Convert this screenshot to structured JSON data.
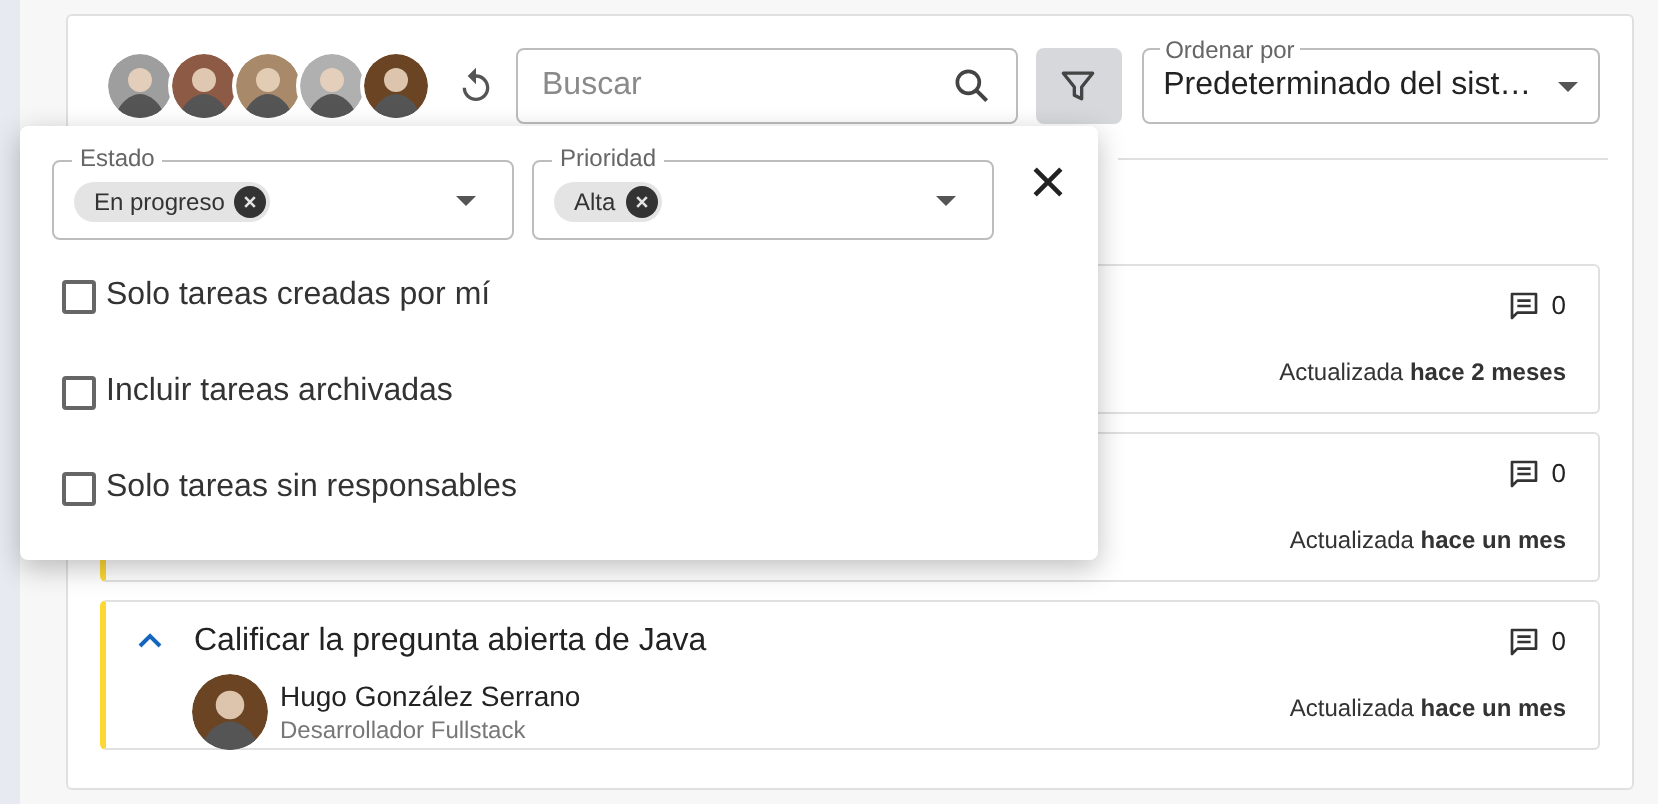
{
  "toolbar": {
    "search": {
      "placeholder": "Buscar"
    },
    "filter_button": {
      "selected": true
    },
    "sort": {
      "label": "Ordenar por",
      "value": "Predeterminado del sist…"
    }
  },
  "tasks": [
    {
      "comments": "0",
      "updated": "Actualizada **hace 2 meses**"
    },
    {
      "comments": "0",
      "updated": "Actualizada **hace un mes**"
    },
    {
      "expanded": true,
      "title": "Calificar la pregunta abierta de Java",
      "person": "Hugo González Serrano",
      "role": "Desarrollador Fullstack",
      "comments": "0",
      "updated": "Actualizada **hace un mes**"
    }
  ],
  "filter_panel": {
    "selects": [
      {
        "label": "Estado",
        "chips": [
          "En progreso"
        ]
      },
      {
        "label": "Prioridad",
        "chips": [
          "Alta"
        ]
      }
    ],
    "options": [
      {
        "label": "Solo tareas creadas por mí",
        "checked": false
      },
      {
        "label": "Incluir tareas archivadas",
        "checked": false
      },
      {
        "label": "Solo tareas sin responsables",
        "checked": false
      }
    ]
  }
}
